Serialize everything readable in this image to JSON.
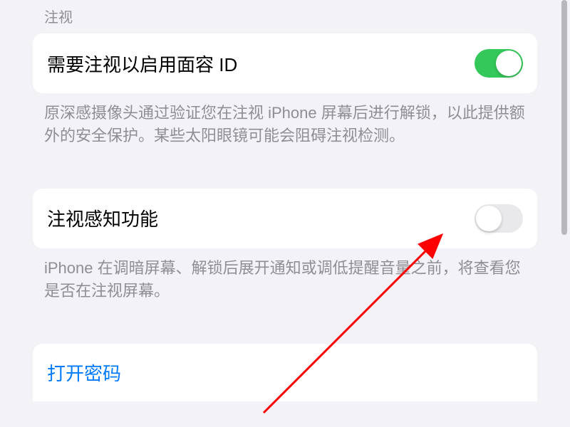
{
  "section": {
    "header": "注视"
  },
  "settings": [
    {
      "label": "需要注视以启用面容 ID",
      "description": "原深感摄像头通过验证您在注视 iPhone 屏幕后进行解锁，以此提供额外的安全保护。某些太阳眼镜可能会阻碍注视检测。",
      "enabled": true
    },
    {
      "label": "注视感知功能",
      "description": "iPhone 在调暗屏幕、解锁后展开通知或调低提醒音量之前，将查看您是否在注视屏幕。",
      "enabled": false
    }
  ],
  "link": {
    "label": "打开密码"
  }
}
